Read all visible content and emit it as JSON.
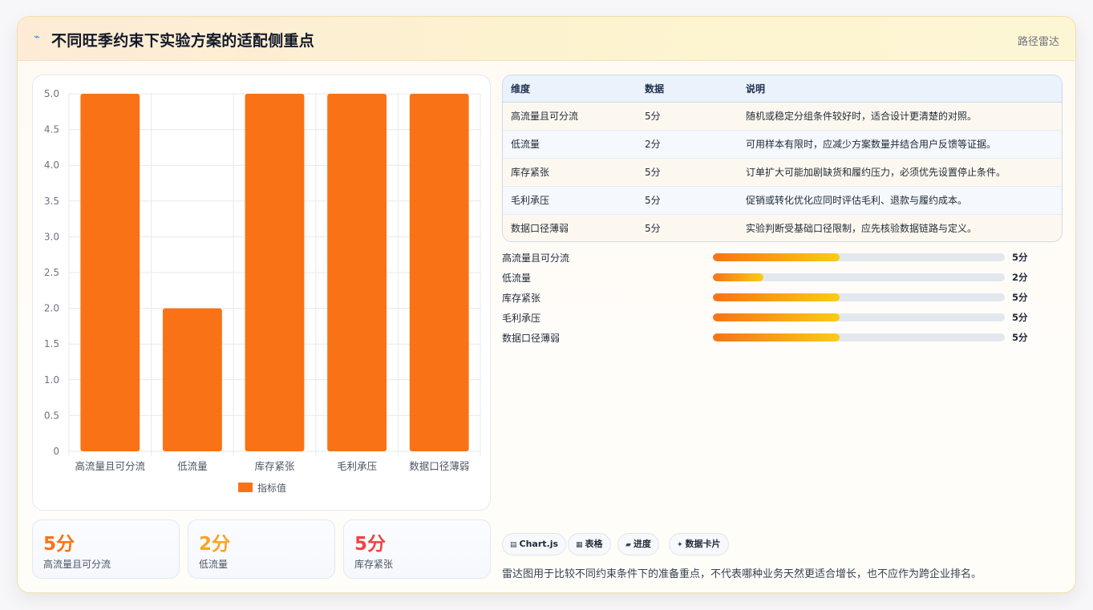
{
  "header": {
    "icon": "spark-icon",
    "title": "不同旺季约束下实验方案的适配侧重点",
    "tag": "路径雷达"
  },
  "chart_data": {
    "type": "bar",
    "categories": [
      "高流量且可分流",
      "低流量",
      "库存紧张",
      "毛利承压",
      "数据口径薄弱"
    ],
    "series": [
      {
        "name": "指标值",
        "values": [
          5,
          2,
          5,
          5,
          5
        ],
        "color": "#f97316"
      }
    ],
    "ylim": [
      0,
      5
    ],
    "yticks": [
      "0",
      "0.5",
      "1.0",
      "1.5",
      "2.0",
      "2.5",
      "3.0",
      "3.5",
      "4.0",
      "4.5",
      "5.0"
    ],
    "grid": true,
    "legend": "bottom"
  },
  "stats": [
    {
      "value": "5分",
      "label": "高流量且可分流",
      "color": "#f97316"
    },
    {
      "value": "2分",
      "label": "低流量",
      "color": "#f5a524"
    },
    {
      "value": "5分",
      "label": "库存紧张",
      "color": "#ef4444"
    }
  ],
  "table": {
    "headers": [
      "维度",
      "数据",
      "说明"
    ],
    "rows": [
      [
        "高流量且可分流",
        "5分",
        "随机或稳定分组条件较好时，适合设计更清楚的对照。"
      ],
      [
        "低流量",
        "2分",
        "可用样本有限时，应减少方案数量并结合用户反馈等证据。"
      ],
      [
        "库存紧张",
        "5分",
        "订单扩大可能加剧缺货和履约压力，必须优先设置停止条件。"
      ],
      [
        "毛利承压",
        "5分",
        "促销或转化优化应同时评估毛利、退款与履约成本。"
      ],
      [
        "数据口径薄弱",
        "5分",
        "实验判断受基础口径限制，应先核验数据链路与定义。"
      ]
    ]
  },
  "progress": [
    {
      "label": "高流量且可分流",
      "value": "5分",
      "fraction": 0.434
    },
    {
      "label": "低流量",
      "value": "2分",
      "fraction": 0.173
    },
    {
      "label": "库存紧张",
      "value": "5分",
      "fraction": 0.434
    },
    {
      "label": "毛利承压",
      "value": "5分",
      "fraction": 0.434
    },
    {
      "label": "数据口径薄弱",
      "value": "5分",
      "fraction": 0.434
    }
  ],
  "chips": [
    {
      "icon": "chart-icon",
      "glyph": "▤",
      "label": "Chart.js"
    },
    {
      "icon": "table-icon",
      "glyph": "▦",
      "label": "表格"
    },
    {
      "icon": "progress-icon",
      "glyph": "▰",
      "label": "进度"
    },
    {
      "icon": "sparkle-icon",
      "glyph": "✦",
      "label": "数据卡片"
    }
  ],
  "note": "雷达图用于比较不同约束条件下的准备重点，不代表哪种业务天然更适合增长，也不应作为跨企业排名。"
}
